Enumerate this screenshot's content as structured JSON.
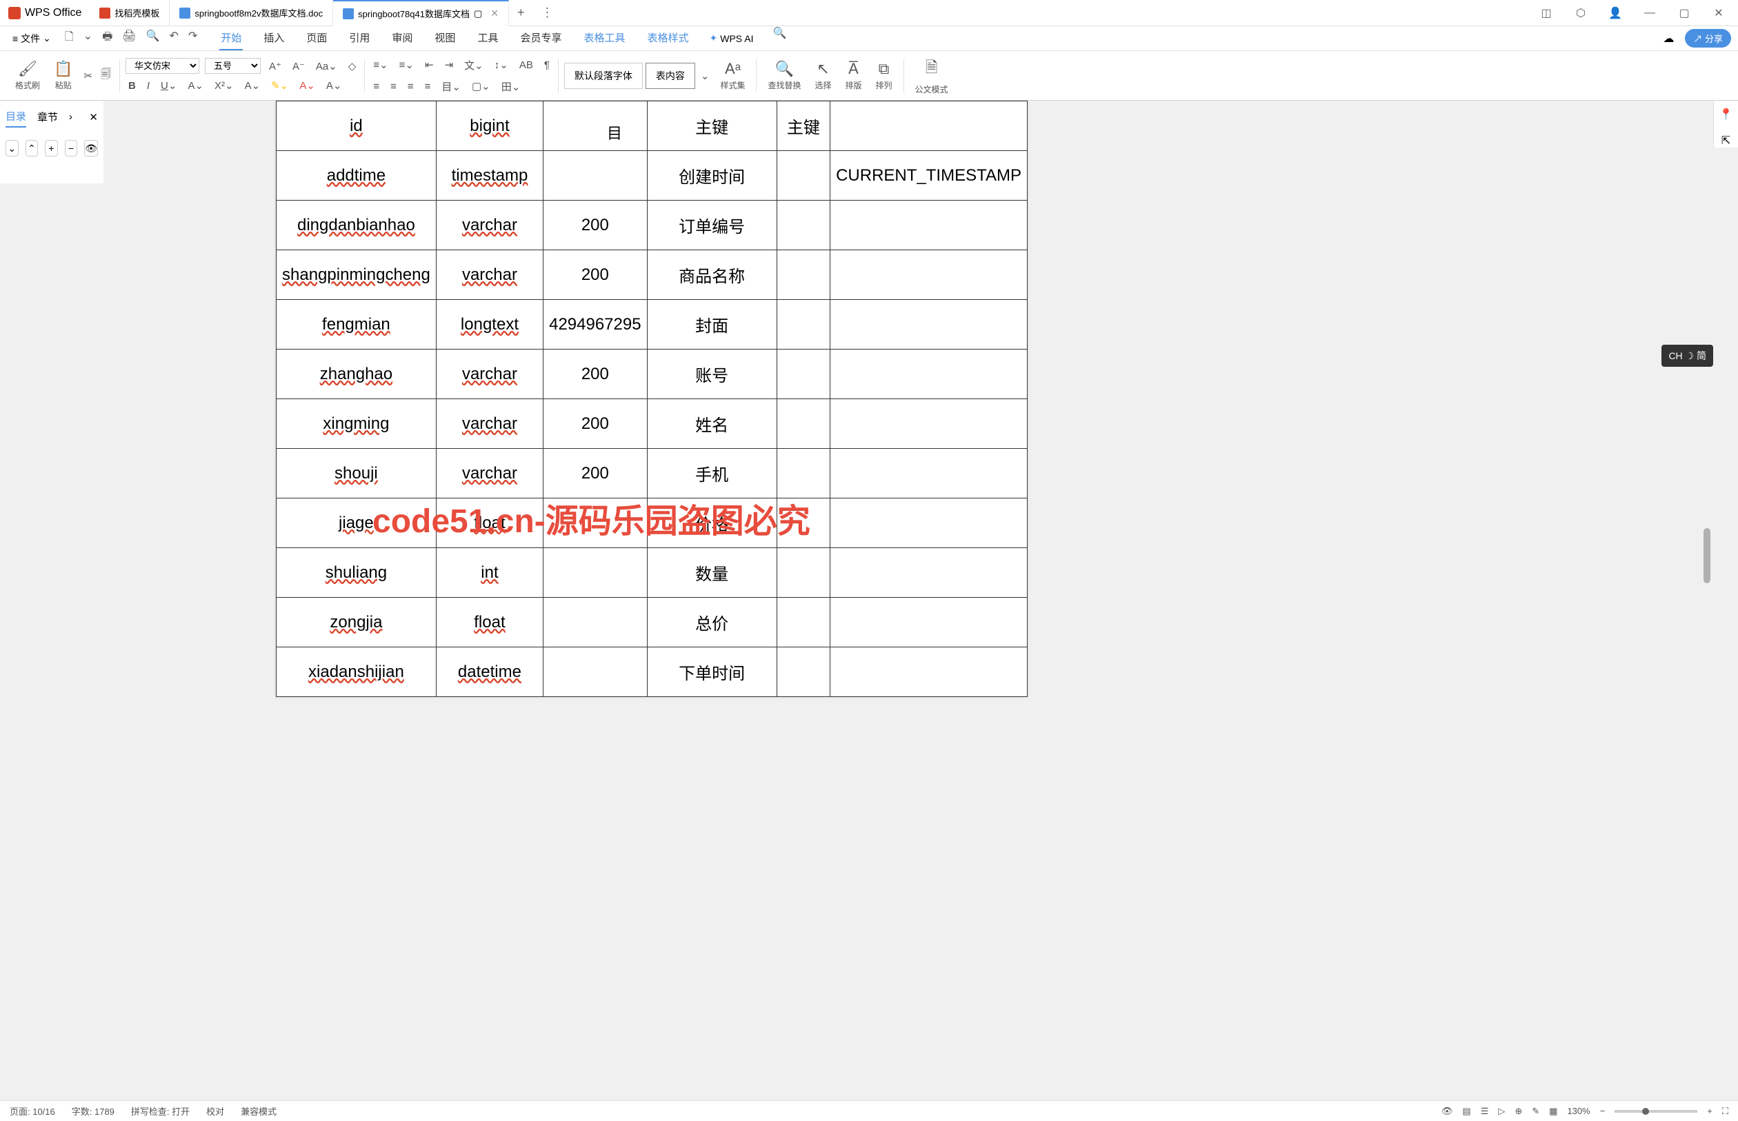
{
  "app": {
    "name": "WPS Office"
  },
  "tabs": [
    {
      "label": "找稻壳模板",
      "icon": "red"
    },
    {
      "label": "springbootf8m2v数据库文档.doc",
      "icon": "blue"
    },
    {
      "label": "springboot78q41数据库文档",
      "icon": "blue",
      "active": true
    }
  ],
  "menuFile": "文件",
  "menuTabs": {
    "start": "开始",
    "insert": "插入",
    "page": "页面",
    "ref": "引用",
    "review": "审阅",
    "view": "视图",
    "tools": "工具",
    "member": "会员专享",
    "tableTools": "表格工具",
    "tableStyle": "表格样式",
    "wpsai": "WPS AI"
  },
  "shareBtn": "分享",
  "toolbar": {
    "formatBrush": "格式刷",
    "paste": "粘贴",
    "fontName": "华文仿宋",
    "fontSize": "五号",
    "styleDefault": "默认段落字体",
    "styleContent": "表内容",
    "styleSet": "样式集",
    "findReplace": "查找替换",
    "select": "选择",
    "layout": "排版",
    "arrange": "排列",
    "docMode": "公文模式"
  },
  "nav": {
    "toc": "目录",
    "chapter": "章节"
  },
  "fieldMarker": "目",
  "table": {
    "rows": [
      {
        "c1": "id",
        "c2": "bigint",
        "c3": "",
        "c4": "主键",
        "c5": "主键",
        "c6": ""
      },
      {
        "c1": "addtime",
        "c2": "timestamp",
        "c3": "",
        "c4": "创建时间",
        "c5": "",
        "c6": "CURRENT_TIMESTAMP"
      },
      {
        "c1": "dingdanbianhao",
        "c2": "varchar",
        "c3": "200",
        "c4": "订单编号",
        "c5": "",
        "c6": ""
      },
      {
        "c1": "shangpinmingcheng",
        "c2": "varchar",
        "c3": "200",
        "c4": "商品名称",
        "c5": "",
        "c6": ""
      },
      {
        "c1": "fengmian",
        "c2": "longtext",
        "c3": "4294967295",
        "c4": "封面",
        "c5": "",
        "c6": ""
      },
      {
        "c1": "zhanghao",
        "c2": "varchar",
        "c3": "200",
        "c4": "账号",
        "c5": "",
        "c6": ""
      },
      {
        "c1": "xingming",
        "c2": "varchar",
        "c3": "200",
        "c4": "姓名",
        "c5": "",
        "c6": ""
      },
      {
        "c1": "shouji",
        "c2": "varchar",
        "c3": "200",
        "c4": "手机",
        "c5": "",
        "c6": ""
      },
      {
        "c1": "jiage",
        "c2": "float",
        "c3": "",
        "c4": "价格",
        "c5": "",
        "c6": ""
      },
      {
        "c1": "shuliang",
        "c2": "int",
        "c3": "",
        "c4": "数量",
        "c5": "",
        "c6": ""
      },
      {
        "c1": "zongjia",
        "c2": "float",
        "c3": "",
        "c4": "总价",
        "c5": "",
        "c6": ""
      },
      {
        "c1": "xiadanshijian",
        "c2": "datetime",
        "c3": "",
        "c4": "下单时间",
        "c5": "",
        "c6": ""
      }
    ]
  },
  "watermarkText": "code51.cn",
  "watermarkCenter": "code51.cn-源码乐园盗图必究",
  "ime": "CH ☽ 简",
  "status": {
    "page": "页面: 10/16",
    "words": "字数: 1789",
    "spell": "拼写检查: 打开",
    "proof": "校对",
    "compat": "兼容模式",
    "zoom": "130%"
  }
}
